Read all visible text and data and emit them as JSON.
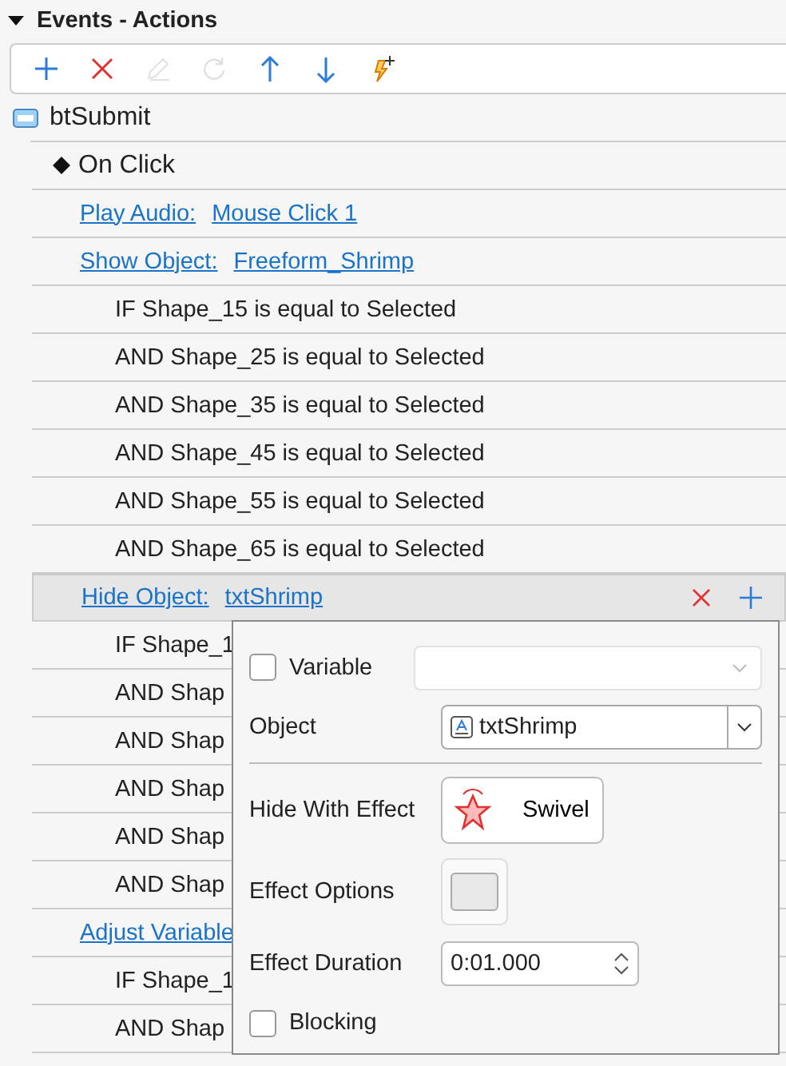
{
  "panel": {
    "title": "Events - Actions",
    "expanded": true
  },
  "toolbar": [
    {
      "kind": "add",
      "disabled": false
    },
    {
      "kind": "delete",
      "disabled": false
    },
    {
      "kind": "edit",
      "disabled": true
    },
    {
      "kind": "refresh",
      "disabled": true
    },
    {
      "kind": "up",
      "disabled": false
    },
    {
      "kind": "down",
      "disabled": false
    },
    {
      "kind": "trigger",
      "disabled": false
    }
  ],
  "tree": [
    {
      "kind": "object",
      "label": "btSubmit",
      "children": [
        {
          "kind": "event",
          "label": "On Click",
          "children": [
            {
              "kind": "action",
              "name": "Play Audio:",
              "target": "Mouse Click 1",
              "selected": false
            },
            {
              "kind": "action",
              "name": "Show Object:",
              "target": "Freeform_Shrimp",
              "selected": false,
              "children": [
                {
                  "label": "IF Shape_15 is equal to Selected"
                },
                {
                  "label": "AND Shape_25 is equal to Selected"
                },
                {
                  "label": "AND Shape_35 is equal to Selected"
                },
                {
                  "label": "AND Shape_45 is equal to Selected"
                },
                {
                  "label": "AND Shape_55 is equal to Selected"
                },
                {
                  "label": "AND Shape_65 is equal to Selected"
                }
              ]
            },
            {
              "kind": "action",
              "name": "Hide Object:",
              "target": "txtShrimp",
              "selected": true,
              "children": [
                {
                  "label": "IF Shape_1"
                },
                {
                  "label": "AND Shap"
                },
                {
                  "label": "AND Shap"
                },
                {
                  "label": "AND Shap"
                },
                {
                  "label": "AND Shap"
                },
                {
                  "label": "AND Shap"
                }
              ]
            },
            {
              "kind": "action",
              "name": "Adjust Variable",
              "selected": false,
              "children": [
                {
                  "label": "IF Shape_1"
                },
                {
                  "label": "AND Shap"
                }
              ]
            }
          ]
        }
      ]
    }
  ],
  "popup": {
    "variable": {
      "label": "Variable",
      "checked": false
    },
    "object": {
      "label": "Object",
      "value": "txtShrimp"
    },
    "effect": {
      "label": "Hide With Effect",
      "value": "Swivel"
    },
    "options": {
      "label": "Effect Options"
    },
    "duration": {
      "label": "Effect Duration",
      "value": "0:01.000"
    },
    "blocking": {
      "label": "Blocking",
      "checked": false
    }
  }
}
